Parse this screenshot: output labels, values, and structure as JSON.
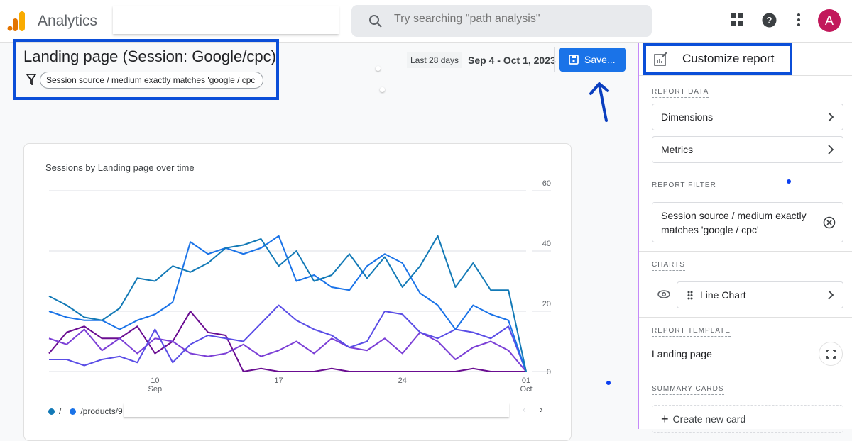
{
  "header": {
    "app_title": "Analytics",
    "search_placeholder": "Try searching \"path analysis\"",
    "avatar_letter": "A"
  },
  "report": {
    "title": "Landing page (Session: Google/cpc)",
    "filter_chip": "Session source / medium exactly matches 'google / cpc'",
    "date_preset": "Last 28 days",
    "date_range": "Sep 4 - Oct 1, 2023",
    "save_label": "Save..."
  },
  "chart_data": {
    "type": "line",
    "title": "Sessions by Landing page over time",
    "x": [
      "Sep 4",
      "Sep 5",
      "Sep 6",
      "Sep 7",
      "Sep 8",
      "Sep 9",
      "Sep 10",
      "Sep 11",
      "Sep 12",
      "Sep 13",
      "Sep 14",
      "Sep 15",
      "Sep 16",
      "Sep 17",
      "Sep 18",
      "Sep 19",
      "Sep 20",
      "Sep 21",
      "Sep 22",
      "Sep 23",
      "Sep 24",
      "Sep 25",
      "Sep 26",
      "Sep 27",
      "Sep 28",
      "Sep 29",
      "Sep 30",
      "Oct 1"
    ],
    "x_ticks": [
      {
        "label": "10",
        "sub": "Sep",
        "index": 6
      },
      {
        "label": "17",
        "sub": "",
        "index": 13
      },
      {
        "label": "24",
        "sub": "",
        "index": 20
      },
      {
        "label": "01",
        "sub": "Oct",
        "index": 27
      }
    ],
    "y_ticks": [
      "0",
      "20",
      "40",
      "60"
    ],
    "ylim": [
      0,
      60
    ],
    "y_axis_side": "right",
    "grid": true,
    "series": [
      {
        "name": "/",
        "color": "#1279b6",
        "values": [
          25,
          22,
          18,
          17,
          21,
          31,
          30,
          35,
          33,
          36,
          41,
          42,
          44,
          35,
          40,
          30,
          32,
          39,
          31,
          38,
          28,
          35,
          45,
          28,
          36,
          27,
          27,
          0
        ]
      },
      {
        "name": "/products/9",
        "color": "#1a73e8",
        "values": [
          20,
          18,
          17,
          17,
          14,
          17,
          19,
          23,
          43,
          39,
          41,
          39,
          41,
          45,
          30,
          32,
          28,
          27,
          35,
          39,
          36,
          26,
          22,
          14,
          22,
          19,
          17,
          0
        ]
      },
      {
        "color": "#5a4de6",
        "values": [
          4,
          4,
          2,
          4,
          5,
          3,
          14,
          3,
          9,
          12,
          11,
          10,
          16,
          22,
          17,
          14,
          12,
          8,
          10,
          20,
          19,
          13,
          11,
          14,
          13,
          11,
          15,
          0
        ]
      },
      {
        "color": "#7b3fd6",
        "values": [
          11,
          9,
          14,
          7,
          11,
          6,
          11,
          10,
          6,
          5,
          6,
          9,
          5,
          7,
          10,
          6,
          11,
          8,
          7,
          11,
          6,
          13,
          10,
          4,
          8,
          10,
          7,
          0
        ]
      },
      {
        "color": "#6a0d91",
        "values": [
          6,
          13,
          15,
          11,
          11,
          15,
          6,
          10,
          20,
          13,
          12,
          0,
          1,
          0,
          0,
          0,
          1,
          0,
          0,
          0,
          0,
          0,
          0,
          0,
          1,
          0,
          0,
          0
        ]
      }
    ]
  },
  "panel": {
    "title": "Customize report",
    "report_data_label": "REPORT DATA",
    "dimensions": "Dimensions",
    "metrics": "Metrics",
    "report_filter_label": "REPORT FILTER",
    "filter_text": "Session source / medium exactly matches 'google / cpc'",
    "charts_label": "CHARTS",
    "chart_item": "Line Chart",
    "report_template_label": "REPORT TEMPLATE",
    "template_name": "Landing page",
    "summary_cards_label": "SUMMARY CARDS",
    "create_card": "Create new card"
  }
}
